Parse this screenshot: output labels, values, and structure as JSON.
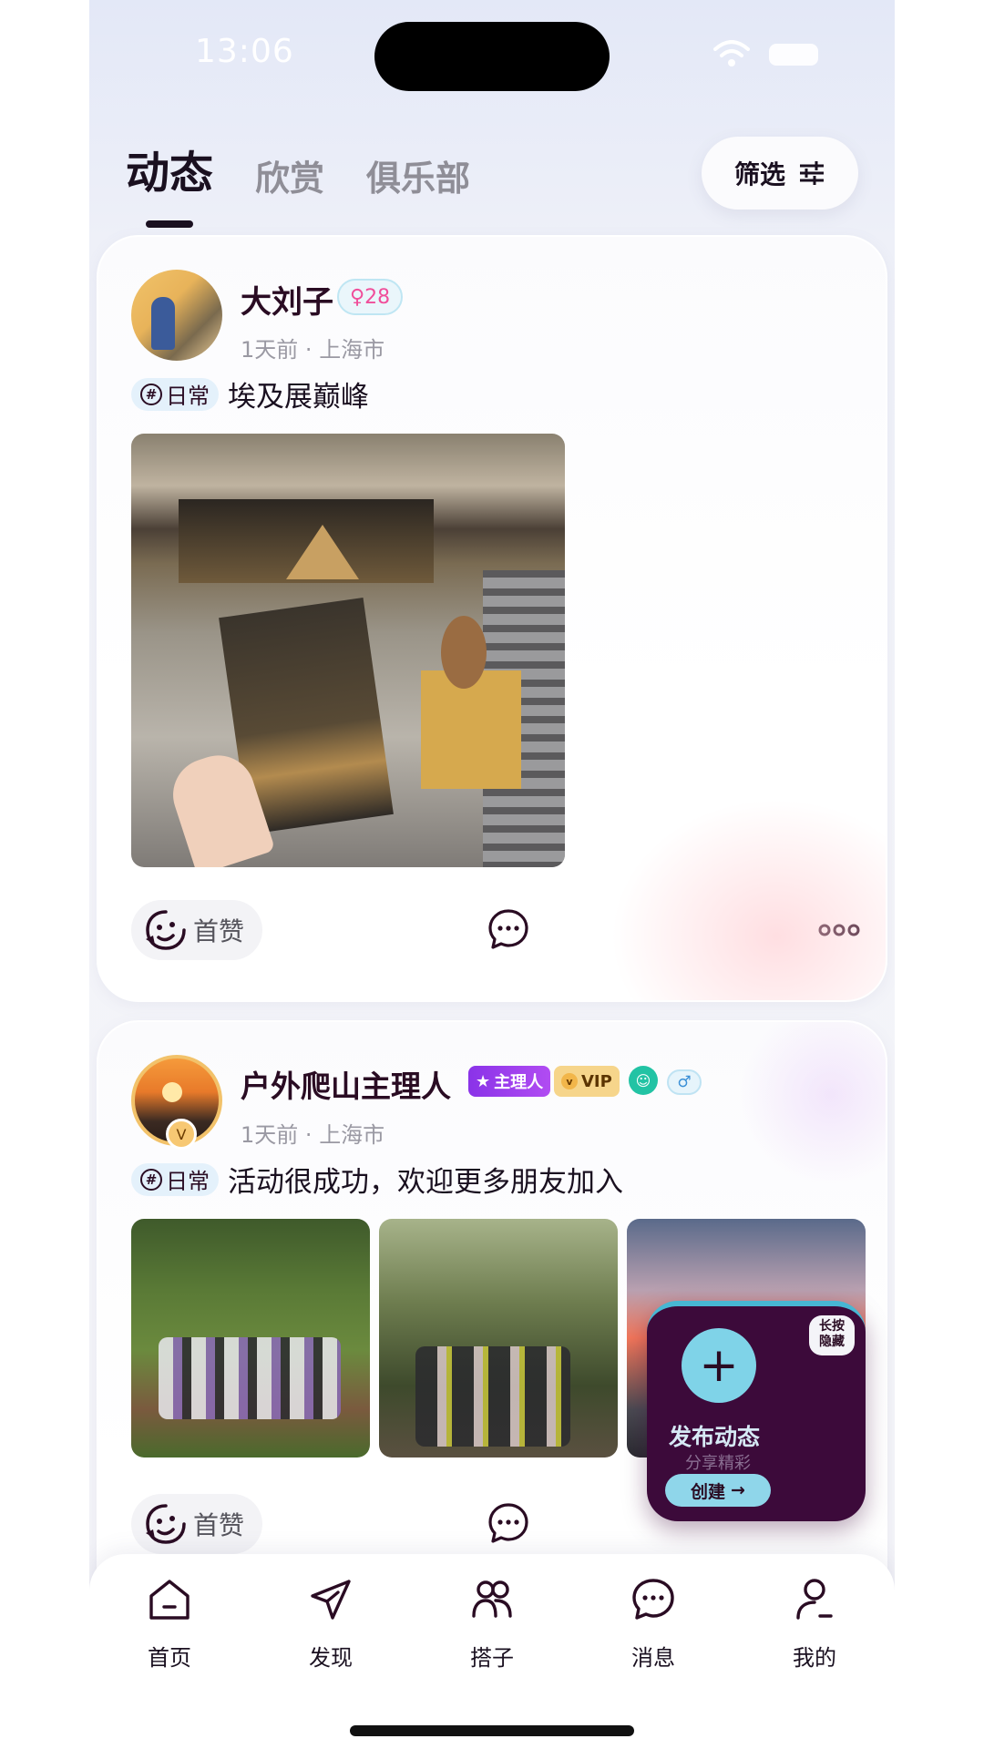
{
  "status_bar": {
    "time": "13:06"
  },
  "tabs": [
    {
      "label": "动态",
      "active": true
    },
    {
      "label": "欣赏",
      "active": false
    },
    {
      "label": "俱乐部",
      "active": false
    }
  ],
  "filter": {
    "label": "筛选"
  },
  "posts": [
    {
      "username": "大刘子",
      "gender_age": "♀28",
      "time": "1天前",
      "location": "上海市",
      "topic": "日常",
      "text": "埃及展巅峰",
      "like_label": "首赞"
    },
    {
      "username": "户外爬山主理人",
      "badges": {
        "organizer": "主理人",
        "vip": "VIP",
        "male": "♂"
      },
      "avatar_badge": "V",
      "time": "1天前",
      "location": "上海市",
      "topic": "日常",
      "text": "活动很成功，欢迎更多朋友加入",
      "like_label": "首赞"
    }
  ],
  "fab": {
    "hint_line1": "长按",
    "hint_line2": "隐藏",
    "title": "发布动态",
    "subtitle": "分享精彩",
    "create_label": "创建"
  },
  "nav": [
    {
      "label": "首页",
      "icon": "home-icon"
    },
    {
      "label": "发现",
      "icon": "send-icon"
    },
    {
      "label": "搭子",
      "icon": "people-icon"
    },
    {
      "label": "消息",
      "icon": "message-icon"
    },
    {
      "label": "我的",
      "icon": "user-icon"
    }
  ],
  "colors": {
    "primary_dark": "#3c0a3a",
    "accent_cyan": "#7fd3e8",
    "badge_purple": "#8a33e8",
    "vip_gold": "#f6d58b",
    "female_pink": "#f04e9a"
  }
}
